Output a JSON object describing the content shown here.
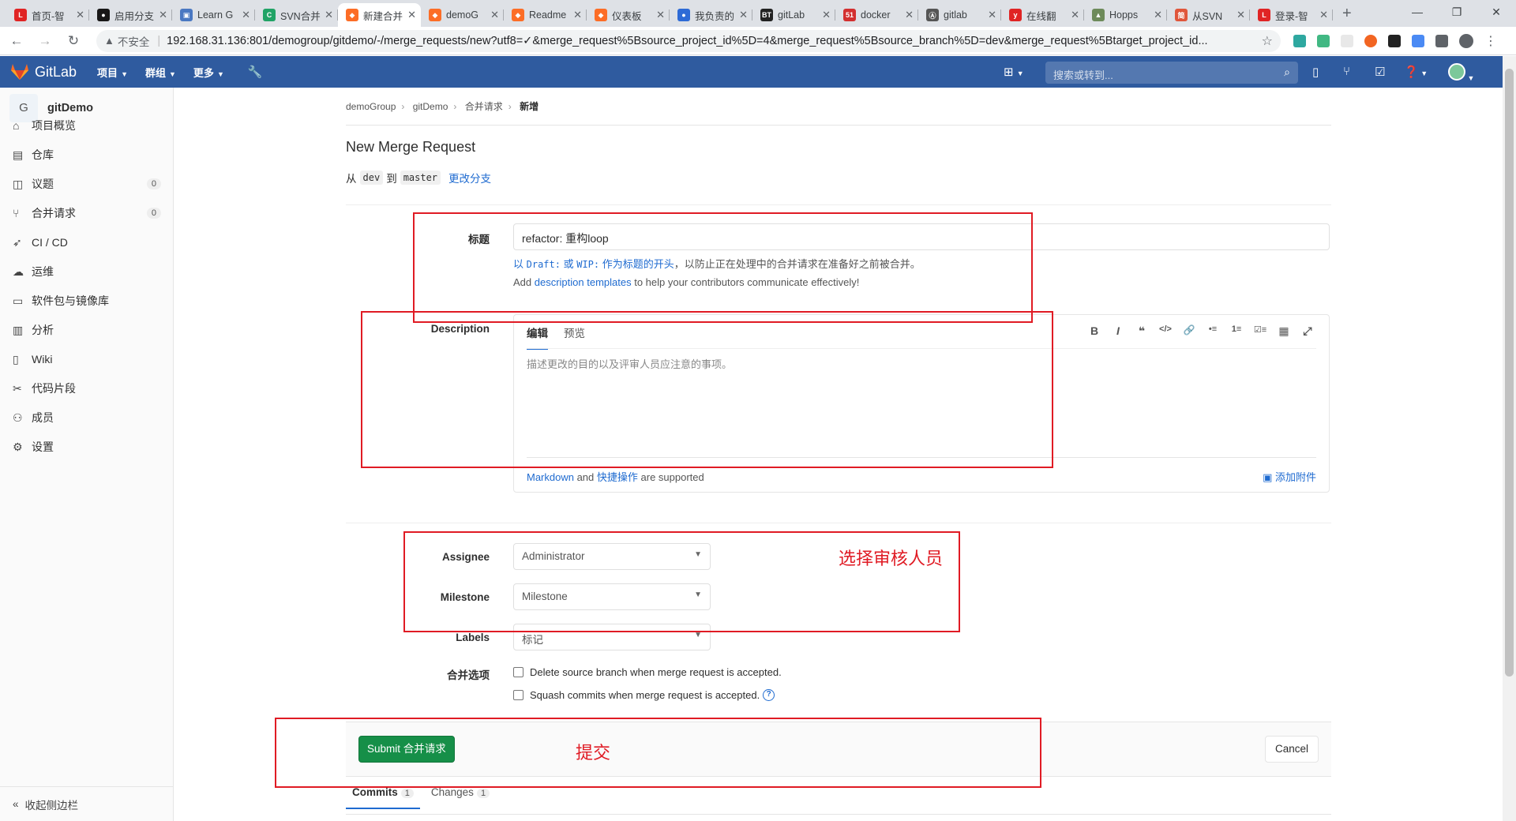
{
  "browser": {
    "tabs": [
      {
        "title": "首页-智",
        "icon_color": "#e02424",
        "icon_letter": "L"
      },
      {
        "title": "启用分支",
        "icon_color": "#181717",
        "icon_letter": "●"
      },
      {
        "title": "Learn G",
        "icon_color": "#4a78c2",
        "icon_letter": "▣"
      },
      {
        "title": "SVN合并",
        "icon_color": "#21a366",
        "icon_letter": "C"
      },
      {
        "title": "新建合并",
        "icon_color": "#fc6d26",
        "icon_letter": "◆",
        "active": true
      },
      {
        "title": "demoG",
        "icon_color": "#fc6d26",
        "icon_letter": "◆"
      },
      {
        "title": "Readme",
        "icon_color": "#fc6d26",
        "icon_letter": "◆"
      },
      {
        "title": "仪表板",
        "icon_color": "#fc6d26",
        "icon_letter": "◆"
      },
      {
        "title": "我负责的",
        "icon_color": "#2e6bd6",
        "icon_letter": "●"
      },
      {
        "title": "gitLab",
        "icon_color": "#222222",
        "icon_letter": "BT"
      },
      {
        "title": "docker",
        "icon_color": "#d32f2f",
        "icon_letter": "51"
      },
      {
        "title": "gitlab",
        "icon_color": "#555555",
        "icon_letter": "Ⓐ"
      },
      {
        "title": "在线翻",
        "icon_color": "#e02424",
        "icon_letter": "y"
      },
      {
        "title": "Hopps",
        "icon_color": "#6d8a5a",
        "icon_letter": "▲"
      },
      {
        "title": "从SVN",
        "icon_color": "#e0563b",
        "icon_letter": "简"
      },
      {
        "title": "登录-智",
        "icon_color": "#e02424",
        "icon_letter": "L"
      }
    ],
    "new_tab": "+",
    "window_controls": [
      "—",
      "❐",
      "✕"
    ],
    "insecure_label": "不安全",
    "url": "192.168.31.136:801/demogroup/gitdemo/-/merge_requests/new?utf8=✓&merge_request%5Bsource_project_id%5D=4&merge_request%5Bsource_branch%5D=dev&merge_request%5Btarget_project_id..."
  },
  "header": {
    "brand": "GitLab",
    "menus": [
      "项目",
      "群组",
      "更多"
    ],
    "search_placeholder": "搜索或转到..."
  },
  "sidebar": {
    "project_avatar": "G",
    "project_name": "gitDemo",
    "items": [
      {
        "label": "项目概览",
        "icon": "home-icon"
      },
      {
        "label": "仓库",
        "icon": "doc-icon"
      },
      {
        "label": "议题",
        "icon": "issues-icon",
        "badge": "0"
      },
      {
        "label": "合并请求",
        "icon": "merge-icon",
        "badge": "0"
      },
      {
        "label": "CI / CD",
        "icon": "rocket-icon"
      },
      {
        "label": "运维",
        "icon": "cloud-icon"
      },
      {
        "label": "软件包与镜像库",
        "icon": "package-icon"
      },
      {
        "label": "分析",
        "icon": "chart-icon"
      },
      {
        "label": "Wiki",
        "icon": "book-icon"
      },
      {
        "label": "代码片段",
        "icon": "snippet-icon"
      },
      {
        "label": "成员",
        "icon": "users-icon"
      },
      {
        "label": "设置",
        "icon": "gear-icon"
      }
    ],
    "collapse_label": "收起侧边栏"
  },
  "breadcrumb": [
    "demoGroup",
    "gitDemo",
    "合并请求",
    "新增"
  ],
  "page": {
    "title": "New Merge Request",
    "from_text": "从",
    "source_branch": "dev",
    "to_text": "到",
    "target_branch": "master",
    "change_branches": "更改分支"
  },
  "form": {
    "title_label": "标题",
    "title_value": "refactor: 重构loop",
    "wip_hint_pre": "以 ",
    "wip_hint_draft": "Draft:",
    "wip_hint_or": " 或 ",
    "wip_hint_wip": "WIP:",
    "wip_hint_link": " 作为标题的开头",
    "wip_hint_post": "，以防止正在处理中的合并请求在准备好之前被合并。",
    "tpl_hint_pre": "Add ",
    "tpl_hint_link": "description templates",
    "tpl_hint_post": " to help your contributors communicate effectively!",
    "desc_label": "Description",
    "desc_tab_write": "编辑",
    "desc_tab_preview": "预览",
    "desc_placeholder": "描述更改的目的以及评审人员应注意的事项。",
    "toolbar": [
      "B",
      "I",
      "❝",
      "</>",
      "🔗",
      "•≡",
      "1≡",
      "☑≡",
      "▦",
      "⤢"
    ],
    "md_link": "Markdown",
    "md_and": " and ",
    "quick_link": "快捷操作",
    "md_supported": " are supported",
    "attach_label": "添加附件",
    "assignee_label": "Assignee",
    "assignee_value": "Administrator",
    "milestone_label": "Milestone",
    "milestone_value": "Milestone",
    "labels_label": "Labels",
    "labels_value": "标记",
    "merge_options_label": "合并选项",
    "delete_branch_text": "Delete source branch when merge request is accepted.",
    "squash_text": "Squash commits when merge request is accepted.",
    "submit_label": "Submit 合并请求",
    "cancel_label": "Cancel"
  },
  "bottom_tabs": [
    {
      "label": "Commits",
      "count": "1"
    },
    {
      "label": "Changes",
      "count": "1"
    }
  ],
  "annotations": {
    "reviewer_note": "选择审核人员",
    "submit_note": "提交",
    "color": "#e01b24"
  }
}
